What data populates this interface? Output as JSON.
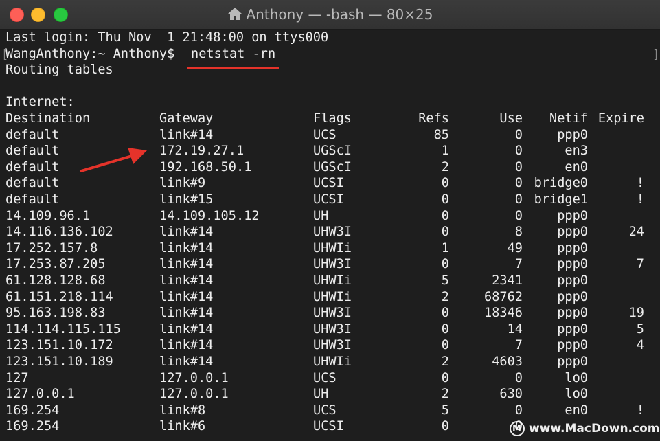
{
  "window": {
    "title": "Anthony — -bash — 80×25",
    "colors": {
      "background": "#1e1e1e",
      "text": "#ededed",
      "annotation": "#e5332a"
    }
  },
  "terminal": {
    "last_login": "Last login: Thu Nov  1 21:48:00 on ttys000",
    "prompt": "WangAnthony:~ Anthony$ ",
    "command": "netstat -rn",
    "routing_header": "Routing tables",
    "internet_label": "Internet:",
    "columns": [
      "Destination",
      "Gateway",
      "Flags",
      "Refs",
      "Use",
      "Netif",
      "Expire"
    ],
    "rows": [
      [
        "default",
        "link#14",
        "UCS",
        "85",
        "0",
        "ppp0",
        ""
      ],
      [
        "default",
        "172.19.27.1",
        "UGScI",
        "1",
        "0",
        "en3",
        ""
      ],
      [
        "default",
        "192.168.50.1",
        "UGScI",
        "2",
        "0",
        "en0",
        ""
      ],
      [
        "default",
        "link#9",
        "UCSI",
        "0",
        "0",
        "bridge0",
        "!"
      ],
      [
        "default",
        "link#15",
        "UCSI",
        "0",
        "0",
        "bridge1",
        "!"
      ],
      [
        "14.109.96.1",
        "14.109.105.12",
        "UH",
        "0",
        "0",
        "ppp0",
        ""
      ],
      [
        "14.116.136.102",
        "link#14",
        "UHW3I",
        "0",
        "8",
        "ppp0",
        "24"
      ],
      [
        "17.252.157.8",
        "link#14",
        "UHWIi",
        "1",
        "49",
        "ppp0",
        ""
      ],
      [
        "17.253.87.205",
        "link#14",
        "UHW3I",
        "0",
        "7",
        "ppp0",
        "7"
      ],
      [
        "61.128.128.68",
        "link#14",
        "UHWIi",
        "5",
        "2341",
        "ppp0",
        ""
      ],
      [
        "61.151.218.114",
        "link#14",
        "UHWIi",
        "2",
        "68762",
        "ppp0",
        ""
      ],
      [
        "95.163.198.83",
        "link#14",
        "UHW3I",
        "0",
        "18346",
        "ppp0",
        "19"
      ],
      [
        "114.114.115.115",
        "link#14",
        "UHW3I",
        "0",
        "14",
        "ppp0",
        "5"
      ],
      [
        "123.151.10.172",
        "link#14",
        "UHW3I",
        "0",
        "7",
        "ppp0",
        "4"
      ],
      [
        "123.151.10.189",
        "link#14",
        "UHWIi",
        "2",
        "4603",
        "ppp0",
        ""
      ],
      [
        "127",
        "127.0.0.1",
        "UCS",
        "0",
        "0",
        "lo0",
        ""
      ],
      [
        "127.0.0.1",
        "127.0.0.1",
        "UH",
        "2",
        "630",
        "lo0",
        ""
      ],
      [
        "169.254",
        "link#8",
        "UCS",
        "5",
        "0",
        "en0",
        "!"
      ],
      [
        "169.254",
        "link#6",
        "UCSI",
        "0",
        "0",
        "",
        ""
      ]
    ]
  },
  "watermark": {
    "text": "www.MacDown.com"
  }
}
